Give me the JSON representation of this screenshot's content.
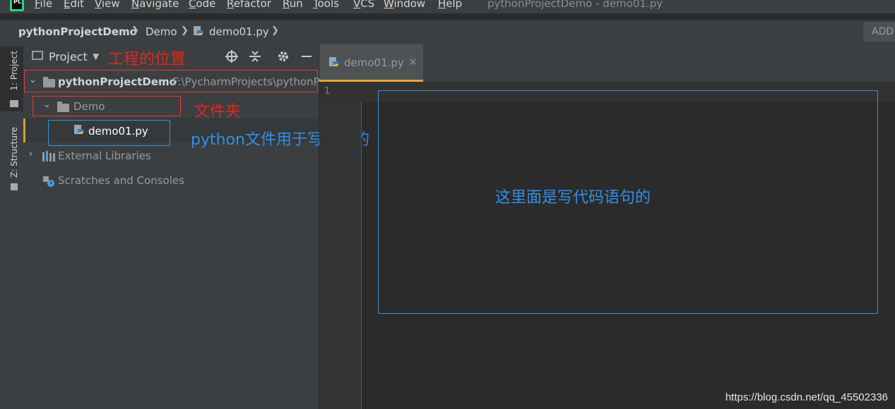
{
  "menubar": {
    "logo": "PC",
    "items": [
      "File",
      "Edit",
      "View",
      "Navigate",
      "Code",
      "Refactor",
      "Run",
      "Tools",
      "VCS",
      "Window",
      "Help"
    ],
    "window_title": "pythonProjectDemo - demo01.py"
  },
  "navbar": {
    "crumbs": [
      "pythonProjectDemo",
      "Demo",
      "demo01.py"
    ],
    "add_label": "ADD"
  },
  "left_strip": {
    "project_tab": "1: Project",
    "structure_tab": "Z: Structure"
  },
  "project_panel": {
    "header_label": "Project",
    "tree": {
      "root_name": "pythonProjectDemo",
      "root_path": "F:\\PycharmProjects\\pythonP",
      "folder_name": "Demo",
      "file_name": "demo01.py",
      "external_libraries": "External Libraries",
      "scratches": "Scratches and Consoles"
    }
  },
  "annotations": {
    "project_location": "工程的位置",
    "folder": "文件夹",
    "python_file": "python文件用于写代码的",
    "editor_area": "这里面是写代码语句的"
  },
  "editor": {
    "tab_label": "demo01.py",
    "line_numbers": [
      "1"
    ]
  },
  "watermark": "https://blog.csdn.net/qq_45502336",
  "colors": {
    "annotation_red": "#e8251b",
    "annotation_blue": "#2f8fe8",
    "tab_accent": "#e8a43c",
    "selection_accent": "#d3a11a"
  }
}
